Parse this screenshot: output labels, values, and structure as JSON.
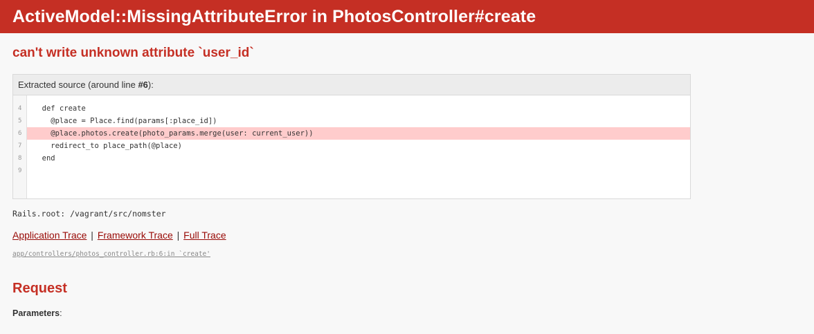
{
  "header": {
    "title": "ActiveModel::MissingAttributeError in PhotosController#create"
  },
  "error": {
    "message": "can't write unknown attribute `user_id`"
  },
  "source": {
    "info_prefix": "Extracted source (around line ",
    "info_line": "#6",
    "info_suffix": "):",
    "line_numbers": [
      "4",
      "5",
      "6",
      "7",
      "8",
      "9"
    ],
    "lines": [
      "  def create",
      "    @place = Place.find(params[:place_id])",
      "    @place.photos.create(photo_params.merge(user: current_user))",
      "    redirect_to place_path(@place)",
      "  end",
      ""
    ],
    "highlighted_line": "6"
  },
  "rails_root": "Rails.root: /vagrant/src/nomster",
  "trace": {
    "application_trace": "Application Trace",
    "framework_trace": "Framework Trace",
    "full_trace": "Full Trace",
    "separator": "|",
    "line": "app/controllers/photos_controller.rb:6:in `create'"
  },
  "request": {
    "heading": "Request",
    "parameters_label": "Parameters",
    "parameters_suffix": ":"
  }
}
